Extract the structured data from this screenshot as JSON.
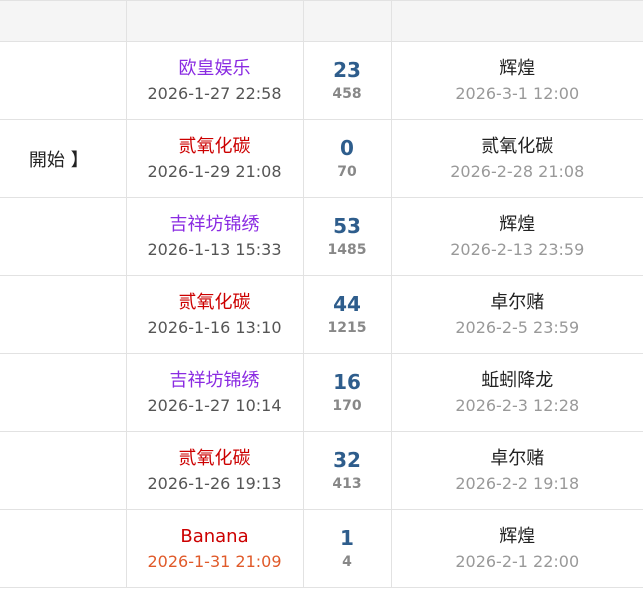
{
  "rows": [
    {
      "title_fragment": "",
      "author": "欧皇娱乐",
      "author_color": "purple",
      "post_time": "2026-1-27 22:58",
      "replies": "23",
      "views": "458",
      "last_user": "辉煌",
      "last_time": "2026-3-1 12:00"
    },
    {
      "title_fragment": "開始 】",
      "author": "贰氧化碳",
      "author_color": "red",
      "post_time": "2026-1-29 21:08",
      "replies": "0",
      "views": "70",
      "last_user": "贰氧化碳",
      "last_time": "2026-2-28 21:08"
    },
    {
      "title_fragment": "",
      "author": "吉祥坊锦绣",
      "author_color": "purple",
      "post_time": "2026-1-13 15:33",
      "replies": "53",
      "views": "1485",
      "last_user": "辉煌",
      "last_time": "2026-2-13 23:59"
    },
    {
      "title_fragment": "",
      "author": "贰氧化碳",
      "author_color": "red",
      "post_time": "2026-1-16 13:10",
      "replies": "44",
      "views": "1215",
      "last_user": "卓尔赌",
      "last_time": "2026-2-5 23:59"
    },
    {
      "title_fragment": "",
      "author": "吉祥坊锦绣",
      "author_color": "purple",
      "post_time": "2026-1-27 10:14",
      "replies": "16",
      "views": "170",
      "last_user": "蚯蚓降龙",
      "last_time": "2026-2-3 12:28"
    },
    {
      "title_fragment": "",
      "author": "贰氧化碳",
      "author_color": "red",
      "post_time": "2026-1-26 19:13",
      "replies": "32",
      "views": "413",
      "last_user": "卓尔赌",
      "last_time": "2026-2-2 19:18"
    },
    {
      "title_fragment": "",
      "author": "Banana",
      "author_color": "red",
      "post_time": "2026-1-31 21:09",
      "post_time_highlight": true,
      "replies": "1",
      "views": "4",
      "last_user": "辉煌",
      "last_time": "2026-2-1 22:00"
    }
  ]
}
